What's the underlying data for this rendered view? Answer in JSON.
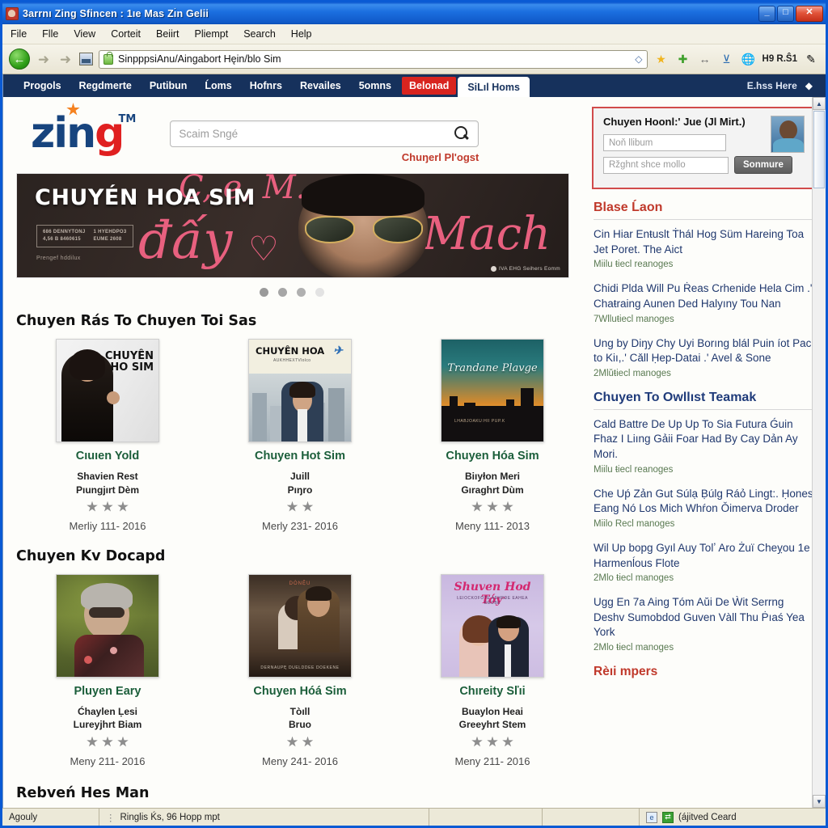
{
  "window": {
    "title": "3arrnı Zing Sfincen : 1ıe Mas Zı̀n Gelii",
    "buttons": {
      "minimize": "_",
      "maximize": "□",
      "close": "✕"
    }
  },
  "menubar": {
    "items": [
      "File",
      "Flle",
      "View",
      "Corteit",
      "Beiirt",
      "Pliempt",
      "Search",
      "Help"
    ]
  },
  "toolbar": {
    "back_icon": "back-arrow-icon",
    "forward_icon": "forward-arrow-icon",
    "address_value": "SinpppsiAnu/Aingabort Hęin/blo Sim",
    "go_icon": "◇",
    "icons": [
      "star-icon",
      "plus-icon",
      "resize-arrows-icon",
      "download-icon",
      "globe-icon"
    ],
    "label": "H9 R.Ŝ1",
    "pen_icon": "pen-icon"
  },
  "sitenav": {
    "items": [
      {
        "label": "Progols",
        "style": "plain"
      },
      {
        "label": "Regdmerte",
        "style": "plain"
      },
      {
        "label": "Putibun",
        "style": "plain"
      },
      {
        "label": "Ĺoms",
        "style": "plain"
      },
      {
        "label": "Hofnrs",
        "style": "plain"
      },
      {
        "label": "Revailes",
        "style": "plain"
      },
      {
        "label": "5omns",
        "style": "plain"
      },
      {
        "label": "Belonad",
        "style": "hot"
      },
      {
        "label": "SiLıl Homs",
        "style": "active"
      }
    ],
    "right_label": "E.hss Here",
    "right_icon": "diamond-icon"
  },
  "brand": {
    "logo_z": "zin",
    "logo_g": "g",
    "logo_tm": "TM",
    "star_icon": "star-burst-icon"
  },
  "search": {
    "placeholder": "Scaim Sngé",
    "icon": "search-icon",
    "sublink": "Chuŋerl Pl'ogst"
  },
  "hero": {
    "title": "CHUYÉN HOA SIM",
    "box_left_line1": "686 DENNYTONJ",
    "box_left_line2": "4,56 B 8460615",
    "box_right_line1": "1 HYEHDPO3",
    "box_right_line2": "EUME 2608",
    "subtext": "Prengef hddilux",
    "script_1": "C, e, M.",
    "script_2": "đấy",
    "script_3": "♡",
    "script_4": "-Mach",
    "credit": "IVA EHG Seihers Eomm",
    "dots": [
      "1",
      "2",
      "3",
      "4"
    ],
    "active_dot": 1
  },
  "sections": [
    {
      "heading": "Chuyen Rás To Chuyen Toi Sas",
      "cards": [
        {
          "title": "Cıuıen Yold",
          "sub_line1": "Shavien Rest",
          "sub_line2": "Pıungjırt Dèm",
          "stars": 3,
          "date": "Merliy 111‑ 2016",
          "poster_text_1": "CHUYÊN",
          "poster_text_2": "HO SIM",
          "poster_kind": "woman-black"
        },
        {
          "title": "Chuyen Hot Sim",
          "sub_line1": "Juill",
          "sub_line2": "Pıŋro",
          "stars": 2,
          "date": "Merly 231‑ 2016",
          "poster_text_1": "CHUYÊN HOA",
          "poster_text_2": "",
          "poster_kind": "man-city"
        },
        {
          "title": "Chuyen Hóa Sim",
          "sub_line1": "Biıyłon Meri",
          "sub_line2": "Gıraghrt Dùm",
          "stars": 3,
          "date": "Meny 111‑ 2013",
          "poster_text_1": "Trandane Plavge",
          "poster_text_2": "",
          "poster_kind": "sunset-city"
        }
      ]
    },
    {
      "heading": "Chuyen Kv Docapd",
      "cards": [
        {
          "title": "Pluyen Eary",
          "sub_line1": "Ćhaylen Ḷesi",
          "sub_line2": "Lureyjhrt Biam",
          "stars": 3,
          "date": "Meny 211‑ 2016",
          "poster_text_1": "",
          "poster_text_2": "",
          "poster_kind": "older-man"
        },
        {
          "title": "Chuyen Hóá Sim",
          "sub_line1": "Tòıll",
          "sub_line2": "Bruo",
          "stars": 2,
          "date": "Meny 241‑ 2016",
          "poster_text_1": "DÒNỆU",
          "poster_text_2": "",
          "poster_kind": "couple-sepia"
        },
        {
          "title": "Chıreity Sľıi",
          "sub_line1": "Buaylon Heai",
          "sub_line2": "Greeyhrt Stem",
          "stars": 3,
          "date": "Meny 211‑ 2016",
          "poster_text_1": "Shuven Hod Tóƴ",
          "poster_text_2": "",
          "poster_kind": "pink-couple"
        }
      ]
    }
  ],
  "bottom_heading": "Rebveń Hes Man",
  "login": {
    "title": "Chuyen Hoonl:' Jue (Jl Mirt.)",
    "user_placeholder": "Noň llibum",
    "pass_placeholder": "Ržghnt shce mollo",
    "button": "Sonmure",
    "avatar_icon": "user-avatar"
  },
  "sidebar": {
    "section1": {
      "heading": "Blase Ĺaon",
      "items": [
        {
          "text": "Cin Hiar Enŧuslt Ṫhál Hog Süm Hareing Toa Jet Poret. The Aict",
          "meta": "Miilu ŧiecl reanoges"
        },
        {
          "text": "Chidi Plda Will Pu Ṙeas Crhenide Hela Cim .' Chaŧraing Aunen Ded Halyıny Tou Nan",
          "meta": "7Wlluŧiecl manoges"
        },
        {
          "text": "Ung by Diŋy Chy Uyi Borıng blál Puin íot Paci to Kiı,.' Cǎll Ḥep-Datai .' Avel & Sone",
          "meta": "2Mlǔŧiecl manoges"
        }
      ]
    },
    "section2": {
      "heading": "Chuyen To Owllıst Teamak",
      "items": [
        {
          "text": "Cald Battre De Up Up To Sia Futura Ǵuin Fhaz I Liıng Gảii Foar Had By Cay Dản Ay Mori.",
          "meta": "Miilu ŧiecl reanoges"
        },
        {
          "text": "Che Uṕ Zản Gut Súlạ Ḅúlg Ráỏ Lingt:. Ḥones Eang Nó Los Mich Whŕon Ǒimerva Droder",
          "meta": "Miilo Recl manoges"
        },
        {
          "text": "Wil Up bopg Gyıl Auy Tolʼ Aro Żuï Cheỵou 1e Harmenĺous Flote",
          "meta": "2Mlo ŧiecl manoges"
        },
        {
          "text": "Ugg En 7a Aing Tóm Aŭi De Ẁit Serrng Deshv Sumobdod Guven Vàll Thu Ṗıaś Yea York",
          "meta": "2Mlo ŧiecl manoges"
        }
      ]
    },
    "footer": "Rèıi mpers"
  },
  "statusbar": {
    "cell1": "Agouly",
    "cell2": "Ringlis Ḱs, 96 Hopp mpt",
    "cell3": "",
    "cell4": "",
    "cell5": "(ájitved Ceard",
    "icon1": "globe-status-icon",
    "icon2": "transfer-status-icon"
  }
}
